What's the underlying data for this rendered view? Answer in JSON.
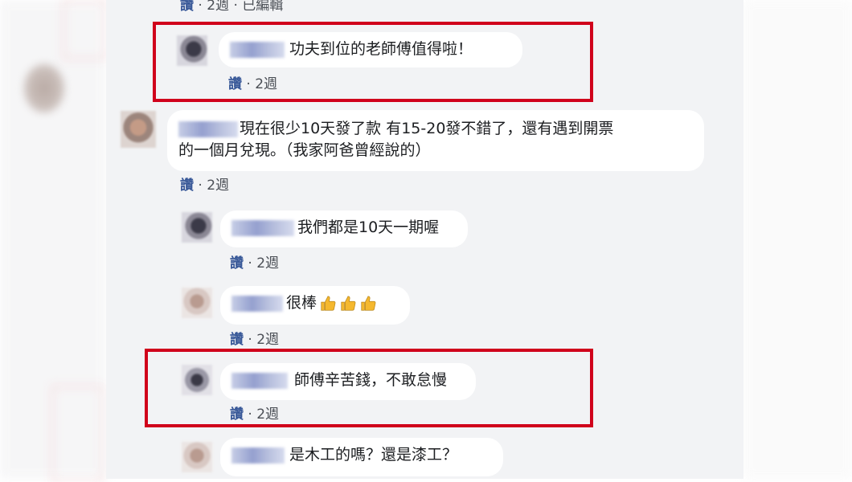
{
  "top_meta": {
    "like": "讚",
    "time": "2週",
    "edited": "已編輯"
  },
  "comments": [
    {
      "text": "功夫到位的老師傅值得啦！",
      "like": "讚",
      "time": "2週"
    },
    {
      "text_line1": "現在很少10天發了款 有15-20發不錯了，還有遇到開票",
      "text_line2": "的一個月兌現。（我家阿爸曾經說的）",
      "like": "讚",
      "time": "2週"
    },
    {
      "text": "我們都是10天一期喔",
      "like": "讚",
      "time": "2週"
    },
    {
      "text": "很棒",
      "emoji": "thumbs-up-icon",
      "like": "讚",
      "time": "2週"
    },
    {
      "text": "師傅辛苦錢，不敢怠慢",
      "like": "讚",
      "time": "2週"
    },
    {
      "text": "是木工的嗎？還是漆工？"
    }
  ],
  "colors": {
    "highlight": "#d0011b",
    "like_link": "#385898",
    "feed_bg": "#f2f3f5"
  }
}
